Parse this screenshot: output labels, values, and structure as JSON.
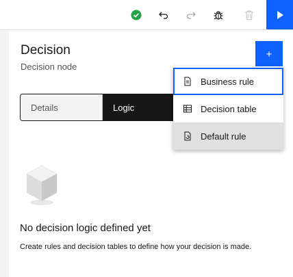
{
  "toolbar": {
    "icons": [
      "check-circle-icon",
      "undo-icon",
      "redo-icon",
      "debug-icon",
      "trash-icon",
      "play-icon"
    ]
  },
  "panel": {
    "title": "Decision",
    "subtitle": "Decision node",
    "add_label": "+"
  },
  "tabs": [
    {
      "label": "Details",
      "selected": false
    },
    {
      "label": "Logic",
      "selected": true
    }
  ],
  "menu": {
    "items": [
      {
        "label": "Business rule",
        "icon": "document-icon",
        "focused": true
      },
      {
        "label": "Decision table",
        "icon": "table-icon",
        "focused": false
      },
      {
        "label": "Default rule",
        "icon": "document-refresh-icon",
        "hovered": true
      }
    ]
  },
  "empty_state": {
    "title": "No decision logic defined yet",
    "description": "Create rules and decision tables to define how your decision is made."
  },
  "colors": {
    "primary": "#0f62fe",
    "success": "#24a148",
    "dark": "#161616",
    "hover": "#e0e0e0"
  }
}
